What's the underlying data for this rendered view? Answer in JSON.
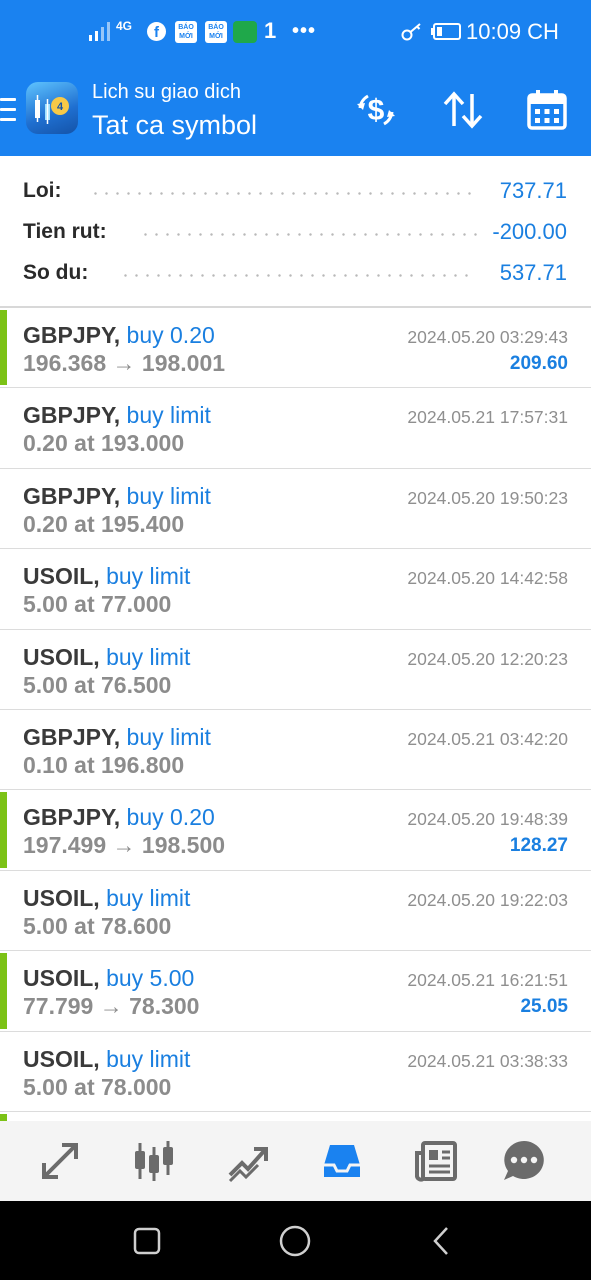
{
  "status_bar": {
    "network": "4G",
    "notif_badges": [
      "BÁO MỚI",
      "BÁO MỚI"
    ],
    "extra_count": "1",
    "more": "•••",
    "time": "10:09 CH"
  },
  "app_bar": {
    "title": "Lich su giao dich",
    "subtitle": "Tat ca symbol",
    "icons": [
      "menu-icon",
      "app-logo",
      "currency-exchange-icon",
      "sort-icon",
      "calendar-icon"
    ]
  },
  "summary": {
    "rows": [
      {
        "label": "Loi:",
        "value": "737.71"
      },
      {
        "label": "Tien rut:",
        "value": "-200.00"
      },
      {
        "label": "So du:",
        "value": "537.71"
      }
    ]
  },
  "trades": [
    {
      "symbol": "GBPJPY,",
      "side": "buy 0.20",
      "detail": "196.368 → 198.001",
      "time": "2024.05.20 03:29:43",
      "profit": "209.60",
      "closed": true
    },
    {
      "symbol": "GBPJPY,",
      "side": "buy limit",
      "detail": "0.20 at 193.000",
      "time": "2024.05.21 17:57:31",
      "profit": "",
      "closed": false
    },
    {
      "symbol": "GBPJPY,",
      "side": "buy limit",
      "detail": "0.20 at 195.400",
      "time": "2024.05.20 19:50:23",
      "profit": "",
      "closed": false
    },
    {
      "symbol": "USOIL,",
      "side": "buy limit",
      "detail": "5.00 at 77.000",
      "time": "2024.05.20 14:42:58",
      "profit": "",
      "closed": false
    },
    {
      "symbol": "USOIL,",
      "side": "buy limit",
      "detail": "5.00 at 76.500",
      "time": "2024.05.20 12:20:23",
      "profit": "",
      "closed": false
    },
    {
      "symbol": "GBPJPY,",
      "side": "buy limit",
      "detail": "0.10 at 196.800",
      "time": "2024.05.21 03:42:20",
      "profit": "",
      "closed": false
    },
    {
      "symbol": "GBPJPY,",
      "side": "buy 0.20",
      "detail": "197.499 → 198.500",
      "time": "2024.05.20 19:48:39",
      "profit": "128.27",
      "closed": true
    },
    {
      "symbol": "USOIL,",
      "side": "buy limit",
      "detail": "5.00 at 78.600",
      "time": "2024.05.20 19:22:03",
      "profit": "",
      "closed": false
    },
    {
      "symbol": "USOIL,",
      "side": "buy 5.00",
      "detail": "77.799 → 78.300",
      "time": "2024.05.21 16:21:51",
      "profit": "25.05",
      "closed": true
    },
    {
      "symbol": "USOIL,",
      "side": "buy limit",
      "detail": "5.00 at 78.000",
      "time": "2024.05.21 03:38:33",
      "profit": "",
      "closed": false
    }
  ],
  "bottom_nav": [
    {
      "name": "quotes-icon",
      "active": false
    },
    {
      "name": "chart-icon",
      "active": false
    },
    {
      "name": "trade-icon",
      "active": false
    },
    {
      "name": "history-icon",
      "active": true
    },
    {
      "name": "news-icon",
      "active": false
    },
    {
      "name": "messages-icon",
      "active": false
    }
  ],
  "system_nav": [
    "recents-button",
    "home-button",
    "back-button"
  ],
  "colors": {
    "header_blue": "#1a82f0",
    "value_blue": "#1a7fe0",
    "closed_bar_green": "#7cc216"
  }
}
